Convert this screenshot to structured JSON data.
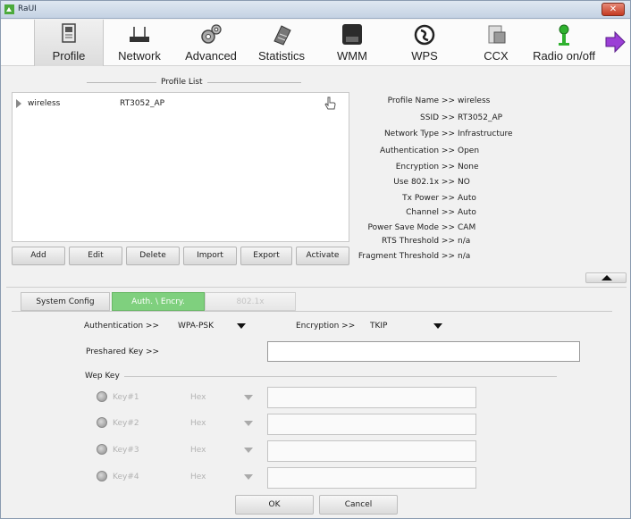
{
  "window": {
    "title": "RaUI",
    "close_glyph": "✕"
  },
  "toolbar": {
    "items": [
      {
        "label": "Profile",
        "icon": "profile-icon"
      },
      {
        "label": "Network",
        "icon": "network-icon"
      },
      {
        "label": "Advanced",
        "icon": "advanced-gears-icon"
      },
      {
        "label": "Statistics",
        "icon": "statistics-icon"
      },
      {
        "label": "WMM",
        "icon": "wmm-icon"
      },
      {
        "label": "WPS",
        "icon": "wps-icon"
      },
      {
        "label": "CCX",
        "icon": "ccx-icon"
      },
      {
        "label": "Radio on/off",
        "icon": "radio-onoff-icon"
      }
    ],
    "next_icon": "arrow-right-icon"
  },
  "profile_list": {
    "title": "Profile List",
    "rows": [
      {
        "name": "wireless",
        "ssid": "RT3052_AP"
      }
    ],
    "buttons": [
      "Add",
      "Edit",
      "Delete",
      "Import",
      "Export",
      "Activate"
    ]
  },
  "profile_info": [
    {
      "key": "Profile Name >>",
      "value": "wireless"
    },
    {
      "key": "SSID >>",
      "value": "RT3052_AP"
    },
    {
      "key": "Network Type >>",
      "value": "Infrastructure"
    },
    {
      "key": "Authentication >>",
      "value": "Open"
    },
    {
      "key": "Encryption >>",
      "value": "None"
    },
    {
      "key": "Use 802.1x >>",
      "value": "NO"
    },
    {
      "key": "Tx Power >>",
      "value": "Auto"
    },
    {
      "key": "Channel >>",
      "value": "Auto"
    },
    {
      "key": "Power Save Mode >>",
      "value": "CAM"
    },
    {
      "key": "RTS Threshold >>",
      "value": "n/a"
    },
    {
      "key": "Fragment Threshold >>",
      "value": "n/a"
    }
  ],
  "tabs": [
    {
      "label": "System Config",
      "state": "inactive"
    },
    {
      "label": "Auth. \\ Encry.",
      "state": "active"
    },
    {
      "label": "802.1x",
      "state": "disabled"
    }
  ],
  "auth": {
    "authentication_label": "Authentication >>",
    "authentication_value": "WPA-PSK",
    "encryption_label": "Encryption >>",
    "encryption_value": "TKIP",
    "preshared_label": "Preshared Key >>",
    "preshared_value": ""
  },
  "wep": {
    "title": "Wep Key",
    "keys": [
      {
        "label": "Key#1",
        "format": "Hex",
        "value": ""
      },
      {
        "label": "Key#2",
        "format": "Hex",
        "value": ""
      },
      {
        "label": "Key#3",
        "format": "Hex",
        "value": ""
      },
      {
        "label": "Key#4",
        "format": "Hex",
        "value": ""
      }
    ]
  },
  "actions": {
    "ok": "OK",
    "cancel": "Cancel"
  }
}
